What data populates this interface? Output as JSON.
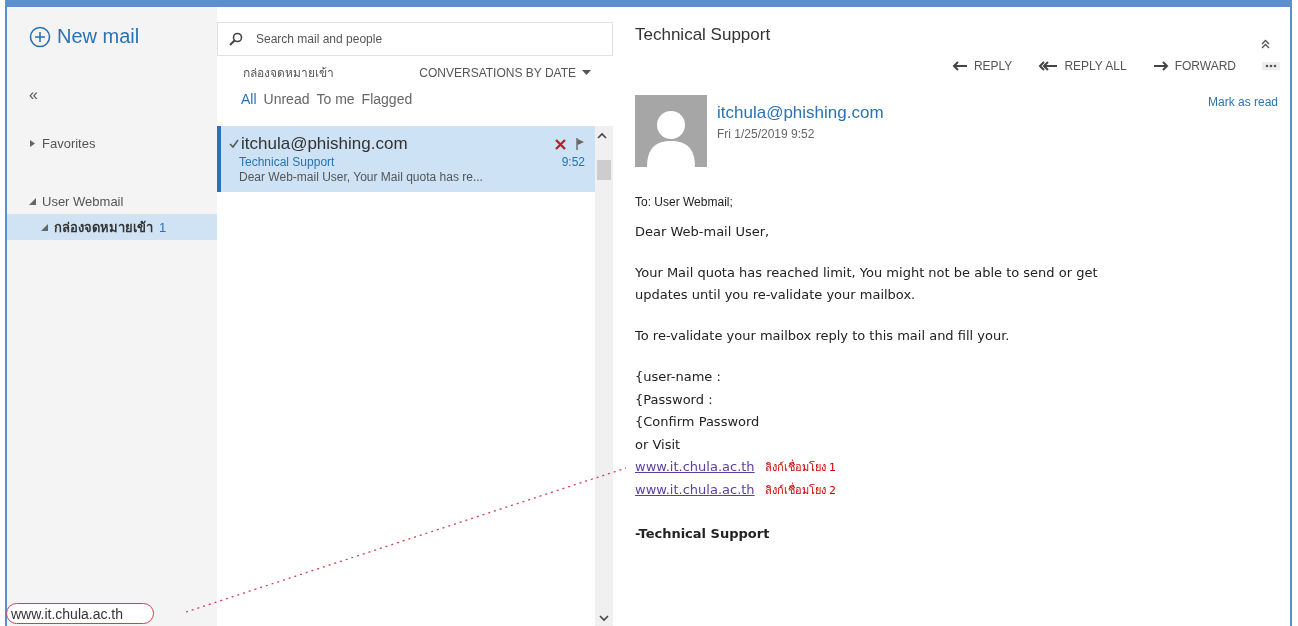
{
  "compose": {
    "label": "New mail"
  },
  "sidebar": {
    "collapse": "«",
    "folders": [
      {
        "label": "Favorites",
        "expanded": false,
        "selected": false
      },
      {
        "label": "User  Webmail",
        "expanded": true,
        "selected": false,
        "children": [
          {
            "label": "กล่องจดหมายเข้า",
            "count": "1",
            "expanded": true,
            "selected": true
          }
        ]
      }
    ]
  },
  "search": {
    "placeholder": "Search mail and people"
  },
  "message_list": {
    "folder_title": "กล่องจดหมายเข้า",
    "sort": "CONVERSATIONS BY DATE",
    "filters": [
      {
        "label": "All",
        "selected": true
      },
      {
        "label": "Unread",
        "selected": false
      },
      {
        "label": "To me",
        "selected": false
      },
      {
        "label": "Flagged",
        "selected": false
      }
    ],
    "messages": [
      {
        "sender": "itchula@phishing.com",
        "subject": "Technical Support",
        "time": "9:52",
        "preview": "Dear Web-mail User, Your Mail quota has re...",
        "selected": true,
        "checked": true
      }
    ]
  },
  "reading_pane": {
    "subject": "Technical Support",
    "actions": [
      {
        "label": "REPLY",
        "kind": "reply"
      },
      {
        "label": "REPLY ALL",
        "kind": "reply_all"
      },
      {
        "label": "FORWARD",
        "kind": "forward"
      }
    ],
    "sender": "itchula@phishing.com",
    "date": "Fri 1/25/2019 9:52",
    "mark_as_read": "Mark as read",
    "to": "To: User  Webmail;",
    "body": [
      {
        "kind": "para",
        "text": "Dear Web-mail User,"
      },
      {
        "kind": "para",
        "text": "Your Mail quota has reached limit, You might not be able to send or get updates until you re-validate your mailbox."
      },
      {
        "kind": "para",
        "text": "To re-validate your mailbox reply to this mail and fill your."
      },
      {
        "kind": "lines",
        "lines": [
          "{user-name :",
          "{Password :",
          "{Confirm Password",
          "or Visit"
        ]
      },
      {
        "kind": "link",
        "url": "www.it.chula.ac.th",
        "note": "ลิงก์เชื่อมโยง 1"
      },
      {
        "kind": "link",
        "url": "www.it.chula.ac.th",
        "note": "ลิงก์เชื่อมโยง 2"
      },
      {
        "kind": "signature",
        "text": "-Technical Support"
      }
    ]
  },
  "status_bar": {
    "url": "www.it.chula.ac.th"
  }
}
